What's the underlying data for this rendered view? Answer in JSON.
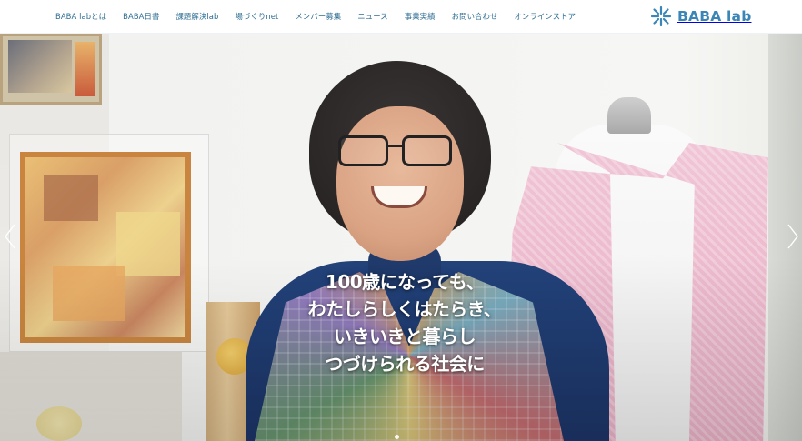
{
  "header": {
    "nav": [
      {
        "label": "BABA labとは"
      },
      {
        "label": "BABA日書"
      },
      {
        "label": "課題解決lab"
      },
      {
        "label": "場づくりnet"
      },
      {
        "label": "メンバー募集"
      },
      {
        "label": "ニュース"
      },
      {
        "label": "事業実績"
      },
      {
        "label": "お問い合わせ"
      },
      {
        "label": "オンラインストア"
      }
    ],
    "logo_text": "BABA lab"
  },
  "hero": {
    "headline_lines": [
      "100歳になっても、",
      "わたしらしくはたらき、",
      "いきいきと暮らし",
      "つづけられる社会に"
    ],
    "prev_icon": "chevron-left-icon",
    "next_icon": "chevron-right-icon"
  },
  "colors": {
    "nav_text": "#2e6e93",
    "logo": "#3a86b6",
    "headline": "#ffffff"
  }
}
